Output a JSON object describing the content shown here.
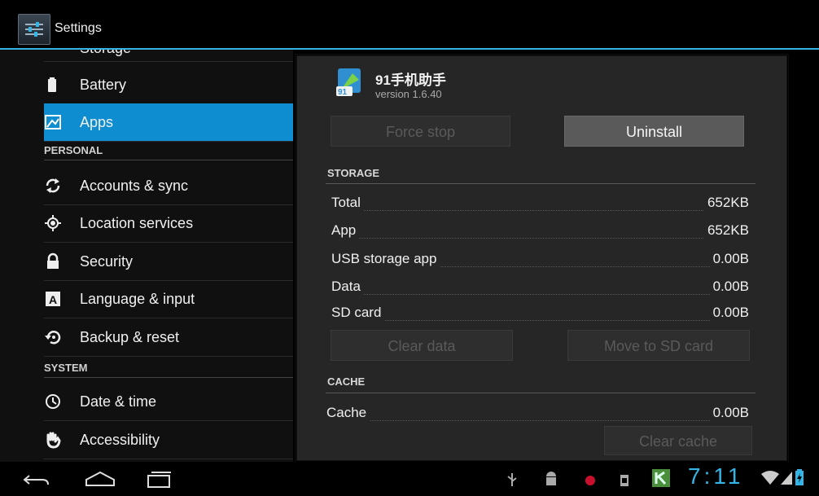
{
  "titlebar": {
    "title": "Settings"
  },
  "sidebar": {
    "partial_item": "Storage",
    "items": [
      {
        "label": "Battery",
        "icon": "battery-icon"
      },
      {
        "label": "Apps",
        "icon": "apps-icon",
        "active": true
      }
    ],
    "personal_header": "PERSONAL",
    "personal": [
      {
        "label": "Accounts & sync",
        "icon": "sync-icon"
      },
      {
        "label": "Location services",
        "icon": "location-icon"
      },
      {
        "label": "Security",
        "icon": "lock-icon"
      },
      {
        "label": "Language & input",
        "icon": "keyboard-icon"
      },
      {
        "label": "Backup & reset",
        "icon": "backup-icon"
      }
    ],
    "system_header": "SYSTEM",
    "system": [
      {
        "label": "Date & time",
        "icon": "clock-icon"
      },
      {
        "label": "Accessibility",
        "icon": "hand-icon"
      }
    ]
  },
  "app": {
    "name": "91手机助手",
    "version": "version 1.6.40"
  },
  "buttons": {
    "force_stop": "Force stop",
    "uninstall": "Uninstall",
    "clear_data": "Clear data",
    "move_to_sd": "Move to SD card",
    "clear_cache": "Clear cache"
  },
  "storage": {
    "header": "STORAGE",
    "rows": [
      {
        "label": "Total",
        "value": "652KB"
      },
      {
        "label": "App",
        "value": "652KB"
      },
      {
        "label": "USB storage app",
        "value": "0.00B"
      },
      {
        "label": "Data",
        "value": "0.00B"
      },
      {
        "label": "SD card",
        "value": "0.00B"
      }
    ]
  },
  "cache": {
    "header": "CACHE",
    "rows": [
      {
        "label": "Cache",
        "value": "0.00B"
      }
    ]
  },
  "statusbar": {
    "clock": "7:11"
  },
  "colors": {
    "accent": "#33b5e5",
    "active_item": "#0e8ed1",
    "panel": "#262626"
  }
}
